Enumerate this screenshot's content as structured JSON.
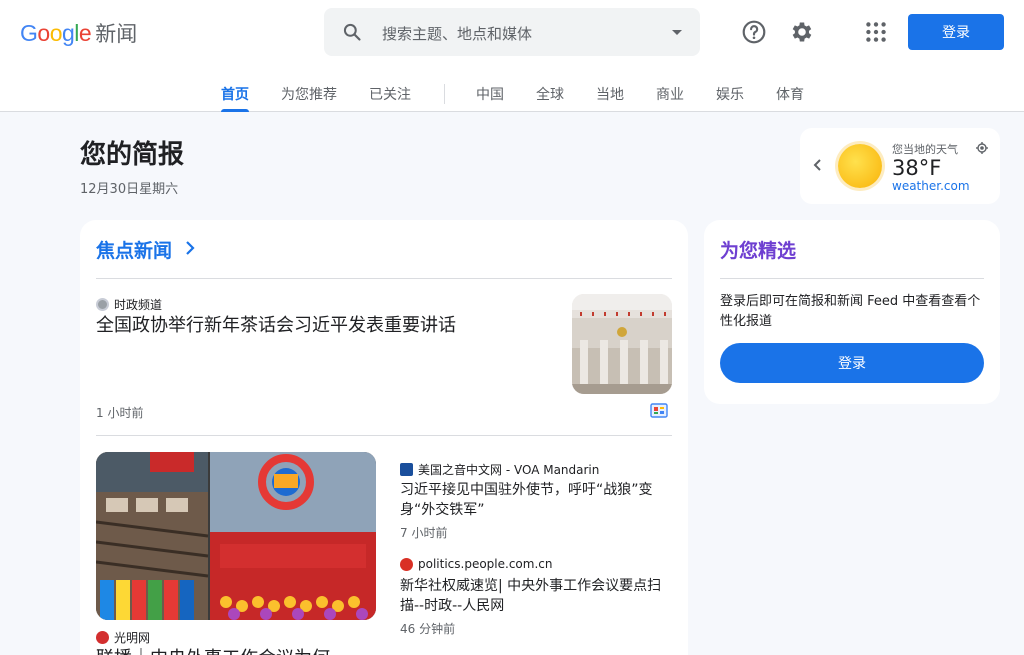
{
  "brand": {
    "g1": "G",
    "g2": "o",
    "g3": "o",
    "g4": "g",
    "g5": "l",
    "g6": "e",
    "product": "新闻"
  },
  "search": {
    "placeholder": "搜索主题、地点和媒体"
  },
  "header": {
    "signin_label": "登录"
  },
  "tabs": [
    {
      "label": "首页",
      "active": true
    },
    {
      "label": "为您推荐"
    },
    {
      "label": "已关注"
    },
    {
      "label": "中国"
    },
    {
      "label": "全球"
    },
    {
      "label": "当地"
    },
    {
      "label": "商业"
    },
    {
      "label": "娱乐"
    },
    {
      "label": "体育"
    }
  ],
  "briefing": {
    "title": "您的简报",
    "date": "12月30日星期六"
  },
  "weather": {
    "label": "您当地的天气",
    "temp": "38°F",
    "source": "weather.com"
  },
  "top_stories": {
    "title": "焦点新闻",
    "lead": {
      "source": "时政频道",
      "headline": "全国政协举行新年茶话会习近平发表重要讲话",
      "time": "1 小时前"
    },
    "second_image_source": "光明网",
    "second_image_headline": "联播｜中央外事工作会议为何...",
    "related": [
      {
        "source": "美国之音中文网 - VOA Mandarin",
        "headline": "习近平接见中国驻外使节，呼吁“战狼”变身“外交铁军”",
        "time": "7 小时前"
      },
      {
        "source": "politics.people.com.cn",
        "headline": "新华社权威速览| 中央外事工作会议要点扫描--时政--人民网",
        "time": "46 分钟前"
      }
    ]
  },
  "for_you": {
    "title": "为您精选",
    "text": "登录后即可在简报和新闻 Feed 中查看查看个性化报道",
    "button": "登录"
  },
  "colors": {
    "accent": "#1a73e8",
    "for_you": "#6e3fd1"
  }
}
